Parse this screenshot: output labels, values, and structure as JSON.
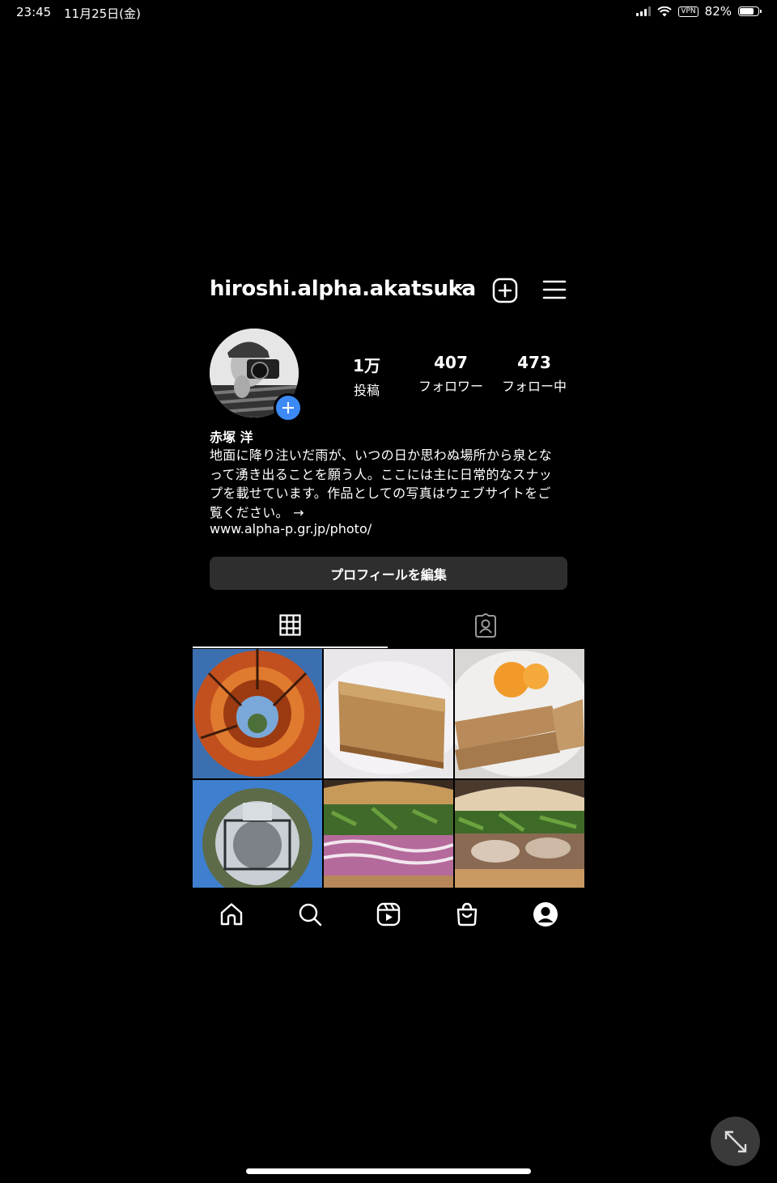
{
  "status_bar": {
    "time": "23:45",
    "date": "11月25日(金)",
    "vpn": "VPN",
    "battery": "82%",
    "battery_level": 0.82
  },
  "header": {
    "username": "hiroshi.alpha.akatsuka"
  },
  "profile": {
    "stats": [
      {
        "value": "1万",
        "label": "投稿"
      },
      {
        "value": "407",
        "label": "フォロワー"
      },
      {
        "value": "473",
        "label": "フォロー中"
      }
    ],
    "name": "赤塚 洋",
    "bio_lines": [
      "地面に降り注いだ雨が、いつの日か思わぬ場所から泉とな",
      "って湧き出ることを願う人。ここには主に日常的なスナッ",
      "プを載せています。作品としての写真はウェブサイトをご",
      "覧ください。 →"
    ],
    "link": "www.alpha-p.gr.jp/photo/",
    "edit_button": "プロフィールを編集"
  },
  "tabs": [
    "grid-icon",
    "tagged-icon"
  ],
  "posts": [
    "autumn-leaves-tiny-planet",
    "baked-loaf",
    "spring-rolls-oranges",
    "park-tiny-planet",
    "banh-mi-onion",
    "banh-mi-chicken"
  ],
  "bottom_nav": [
    "home-icon",
    "search-icon",
    "reels-icon",
    "shop-icon",
    "profile-icon"
  ],
  "colors": {
    "accent": "#3d8af7",
    "background": "#000000",
    "button": "#2e2e2e"
  }
}
